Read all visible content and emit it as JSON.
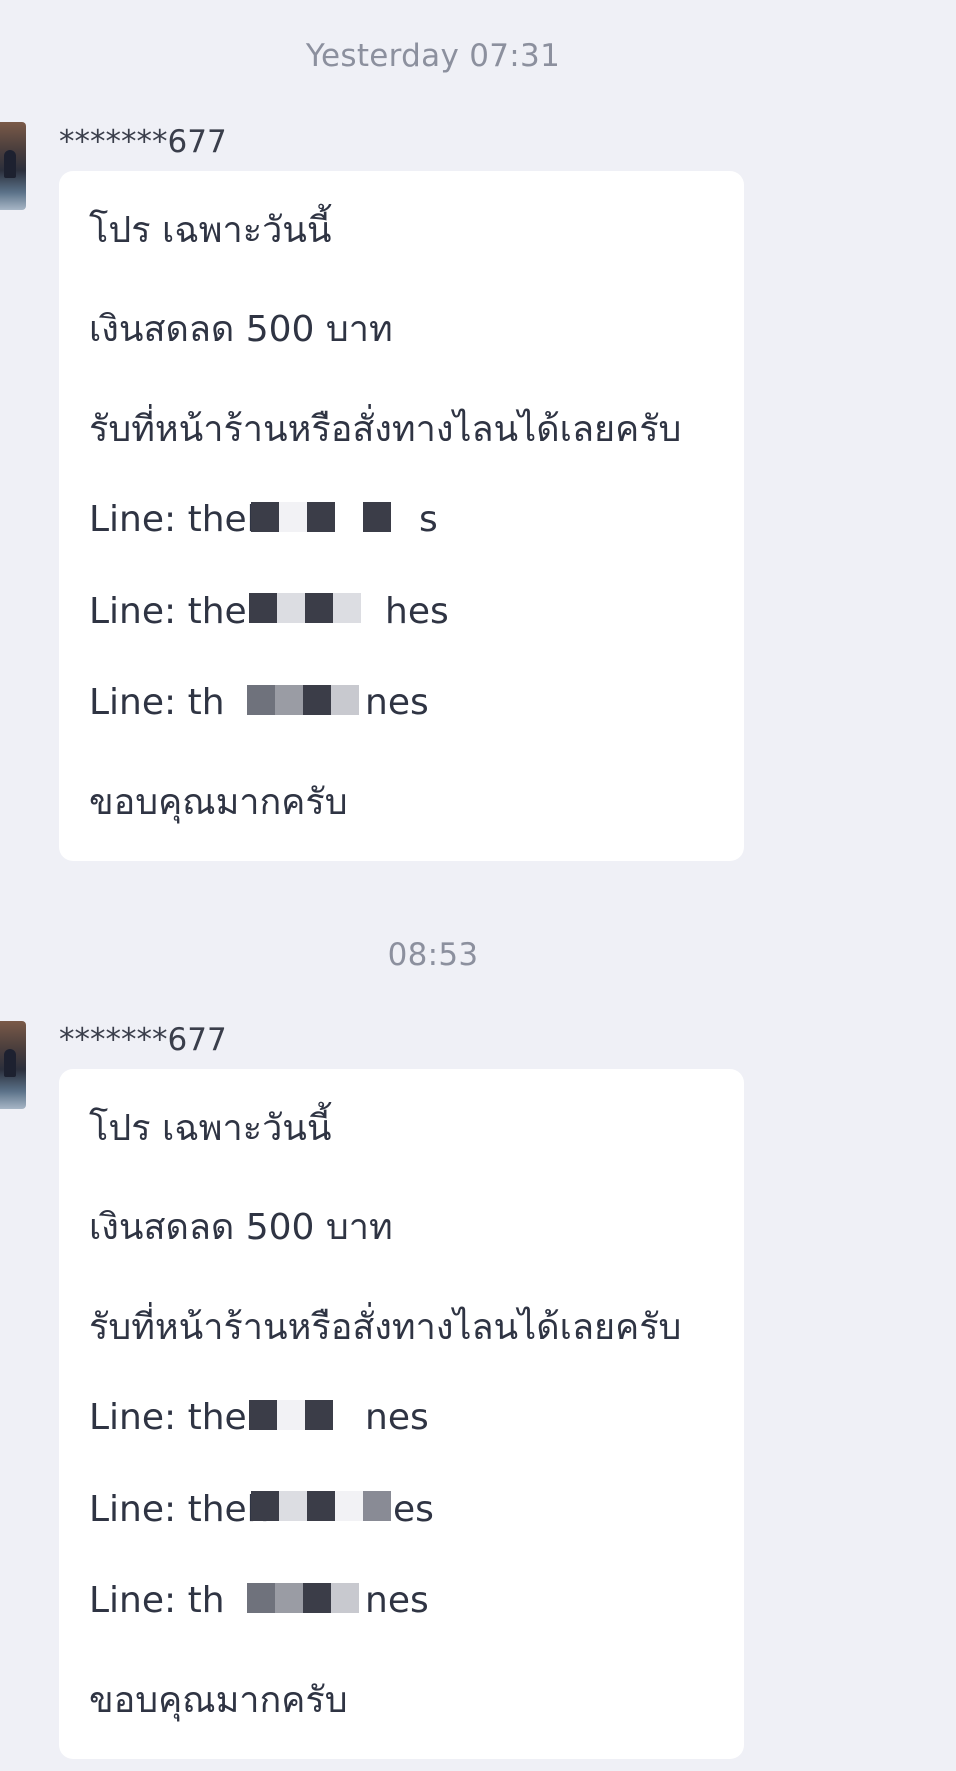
{
  "colors": {
    "background": "#eff0f6",
    "bubble": "#ffffff",
    "text": "#2f3443",
    "timestamp": "#8c909e"
  },
  "groups": [
    {
      "timestamp": "Yesterday 07:31",
      "sender": "*******677",
      "lines": [
        "โปร เฉพาะวันนี้",
        "เงินสดลด 500 บาท",
        "รับที่หน้าร้านหรือสั่งทางไลนได้เลยครับ",
        "Line: theb",
        "Line: the",
        "Line: th",
        "ขอบคุณมากครับ"
      ],
      "line_suffixes": [
        "",
        "",
        "",
        "s",
        "hes",
        "nes",
        ""
      ]
    },
    {
      "timestamp": "08:53",
      "sender": "*******677",
      "lines": [
        "โปร เฉพาะวันนี้",
        "เงินสดลด 500 บาท",
        "รับที่หน้าร้านหรือสั่งทางไลนได้เลยครับ",
        "Line: the",
        "Line: theh",
        "Line: th",
        "ขอบคุณมากครับ"
      ],
      "line_suffixes": [
        "",
        "",
        "",
        "nes",
        "es",
        "nes",
        ""
      ]
    }
  ]
}
